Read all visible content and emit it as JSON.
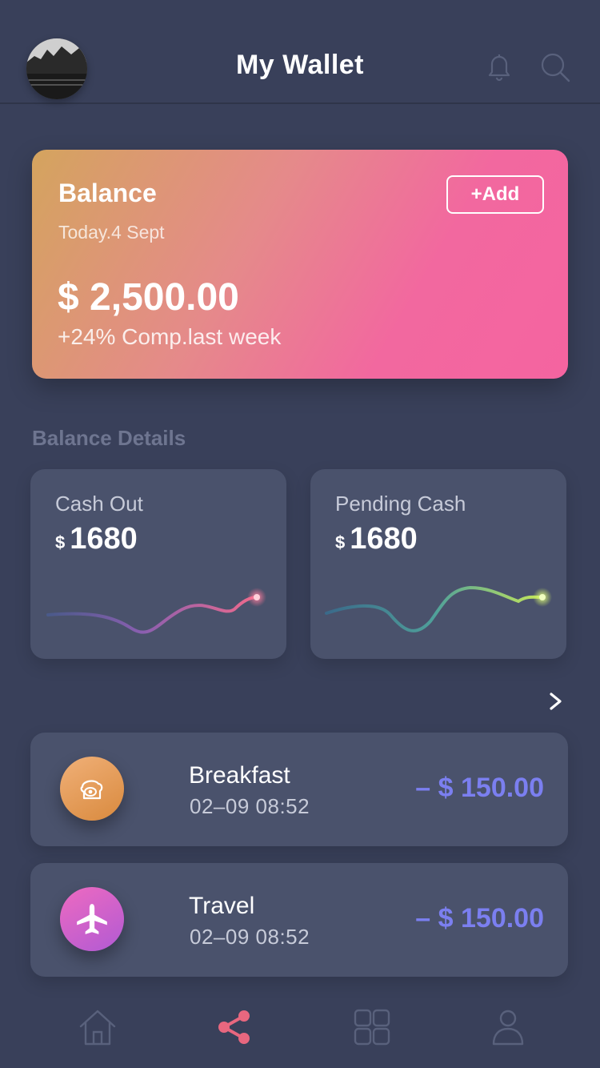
{
  "header": {
    "title": "My Wallet",
    "avatar_icon": "avatar-photo",
    "bell_icon": "bell-icon",
    "search_icon": "search-icon"
  },
  "balance": {
    "label": "Balance",
    "date": "Today.4 Sept",
    "add_label": "+Add",
    "amount": "$ 2,500.00",
    "change": "+24% Comp.last week"
  },
  "details": {
    "title": "Balance Details",
    "cards": [
      {
        "label": "Cash Out",
        "currency": "$",
        "value": "1680"
      },
      {
        "label": "Pending Cash",
        "currency": "$",
        "value": "1680"
      }
    ]
  },
  "more_icon": "chevron-right-icon",
  "transactions": [
    {
      "name": "Breakfast",
      "time": "02–09 08:52",
      "amount": "– $ 150.00",
      "icon": "breakfast-icon"
    },
    {
      "name": "Travel",
      "time": "02–09 08:52",
      "amount": "– $ 150.00",
      "icon": "airplane-icon"
    }
  ],
  "tabs": [
    {
      "name": "home",
      "icon": "home-icon",
      "active": false
    },
    {
      "name": "share",
      "icon": "share-icon",
      "active": true
    },
    {
      "name": "apps",
      "icon": "grid-icon",
      "active": false
    },
    {
      "name": "profile",
      "icon": "user-icon",
      "active": false
    }
  ],
  "colors": {
    "background": "#39405a",
    "card": "#4a526c",
    "accent_amount": "#7b7ff0",
    "active_tab": "#e8677f",
    "inactive_tab": "#59617c"
  }
}
